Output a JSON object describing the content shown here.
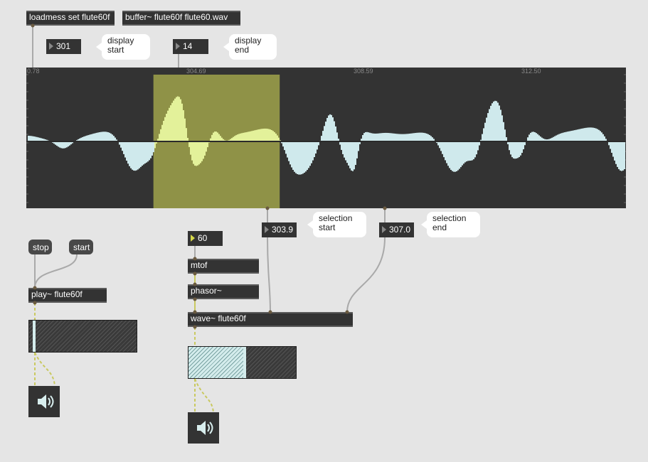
{
  "objects": {
    "loadmess": "loadmess set flute60f",
    "buffer": "buffer~ flute60f flute60.wav",
    "play": "play~ flute60f",
    "mtof": "mtof",
    "phasor": "phasor~",
    "wave": "wave~ flute60f"
  },
  "numbers": {
    "display_start": "301",
    "display_end": "14",
    "selection_start": "303.9",
    "selection_end": "307.0",
    "pitch": "60"
  },
  "comments": {
    "display_start": [
      "display",
      "start"
    ],
    "display_end": [
      "display",
      "end"
    ],
    "selection_start": [
      "selection",
      "start"
    ],
    "selection_end": [
      "selection",
      "end"
    ]
  },
  "messages": {
    "stop": "stop",
    "start": "start"
  },
  "waveform": {
    "ruler_labels": [
      "0.78",
      "304.69",
      "308.59",
      "312.50"
    ],
    "selection_start_ms": 303.9,
    "selection_end_ms": 307.0,
    "background": "#333333",
    "wave_color": "#cfe9ec",
    "selection_color": "#8f9247",
    "selected_wave_color": "#e3f19a"
  },
  "meters": {
    "play_level": 0.03,
    "wave_level": 0.5
  },
  "icons": {
    "dac_left": "speaker-icon",
    "dac_right": "speaker-icon"
  }
}
